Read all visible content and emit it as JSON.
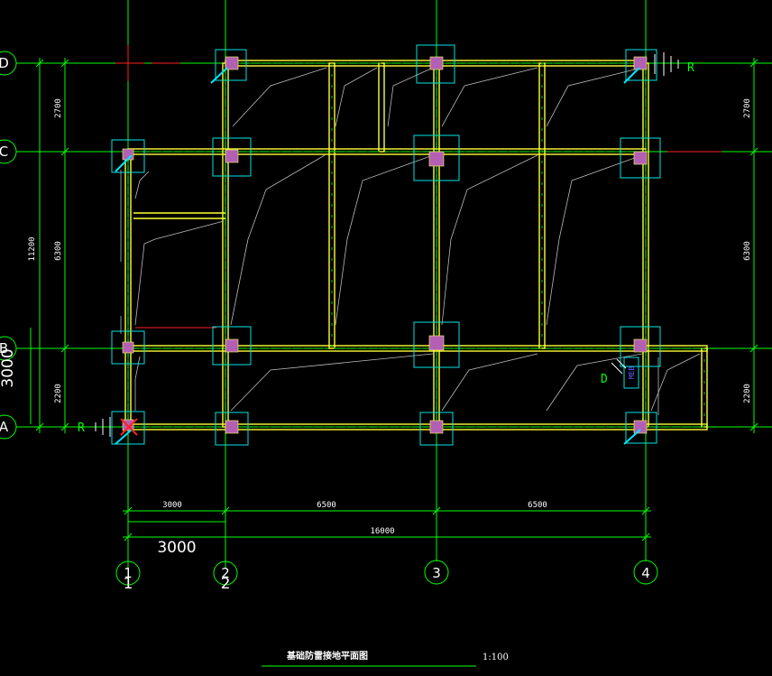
{
  "drawing": {
    "title": "基础防雷接地平面图",
    "scale": "1:100",
    "background_color": "#000000",
    "grid_line_color": "#00ff00",
    "beam_color": "#ffff33",
    "column_color": "#b35fb3",
    "footing_color": "#00e5e5",
    "axis_markers_vertical": [
      "1",
      "2",
      "3",
      "4"
    ],
    "axis_markers_horizontal": [
      "A",
      "B",
      "C",
      "D"
    ],
    "duplicate_axis_labels": [
      "1",
      "2"
    ],
    "dims_bottom": [
      "3000",
      "6500",
      "6500"
    ],
    "dim_bottom_total": "16000",
    "dim_bottom_large": "3000",
    "dims_left": [
      "2700",
      "6300",
      "2200"
    ],
    "dim_left_total": "11200",
    "dim_left_large": "3000",
    "dims_right": [
      "2700",
      "6300",
      "2200"
    ],
    "marker_r": "R",
    "marker_d": "D",
    "marker_box": "MEB"
  }
}
